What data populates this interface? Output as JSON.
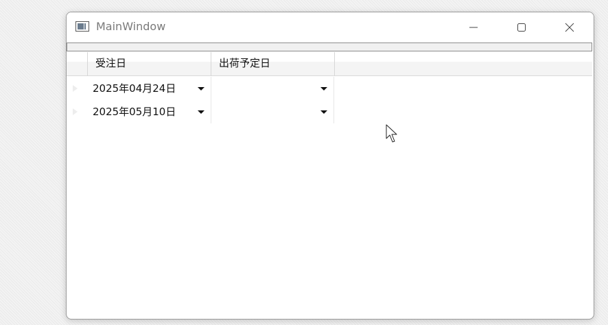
{
  "window": {
    "title": "MainWindow",
    "icon": "window-app-icon",
    "controls": [
      "minimize-icon",
      "maximize-icon",
      "close-icon"
    ]
  },
  "grid": {
    "columns": [
      {
        "header": "受注日"
      },
      {
        "header": "出荷予定日"
      }
    ],
    "rows": [
      {
        "order_date": "2025年04月24日",
        "ship_date": ""
      },
      {
        "order_date": "2025年05月10日",
        "ship_date": ""
      }
    ]
  },
  "colors": {
    "window_bg": "#ffffff",
    "header_bg": "#f4f4f4",
    "grid_line": "#d9d9d9",
    "text": "#111111",
    "title_text": "#7a7a7a"
  }
}
